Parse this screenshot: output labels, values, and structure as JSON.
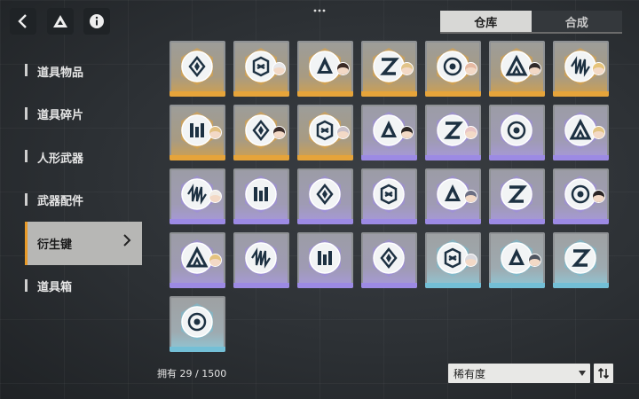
{
  "header": {
    "back_icon": "back-arrow-icon",
    "drive_icon": "triangle-logo-icon",
    "info_icon": "info-icon",
    "more_icon": "ellipsis-icon"
  },
  "tabs": [
    {
      "label": "仓库",
      "active": true
    },
    {
      "label": "合成",
      "active": false
    }
  ],
  "sidebar": {
    "items": [
      {
        "label": "道具物品",
        "active": false
      },
      {
        "label": "道具碎片",
        "active": false
      },
      {
        "label": "人形武器",
        "active": false
      },
      {
        "label": "武器配件",
        "active": false
      },
      {
        "label": "衍生键",
        "active": true
      },
      {
        "label": "道具箱",
        "active": false
      }
    ]
  },
  "items": [
    {
      "rarity": "gold",
      "emblem": "gem-crest-icon",
      "avatar": false
    },
    {
      "rarity": "gold",
      "emblem": "knot-crest-icon",
      "avatar": true,
      "avatar_hair": "#e7e7ea"
    },
    {
      "rarity": "gold",
      "emblem": "triangle-crest-icon",
      "avatar": true,
      "avatar_hair": "#3a2a25"
    },
    {
      "rarity": "gold",
      "emblem": "z-crest-icon",
      "avatar": true,
      "avatar_hair": "#e2c489"
    },
    {
      "rarity": "gold",
      "emblem": "orbit-crest-icon",
      "avatar": true,
      "avatar_hair": "#e5b9a2"
    },
    {
      "rarity": "gold",
      "emblem": "mountain-crest-icon",
      "avatar": true,
      "avatar_hair": "#2f2a2a"
    },
    {
      "rarity": "gold",
      "emblem": "wave-crest-icon",
      "avatar": true,
      "avatar_hair": "#e6c47a"
    },
    {
      "rarity": "gold",
      "emblem": "pillar-crest-icon",
      "avatar": true,
      "avatar_hair": "#e2c081"
    },
    {
      "rarity": "gold",
      "emblem": "snowflake-crest-icon",
      "avatar": true,
      "avatar_hair": "#3b2c29"
    },
    {
      "rarity": "gold",
      "emblem": "slash-crest-icon",
      "avatar": true,
      "avatar_hair": "#c9c0c8"
    },
    {
      "rarity": "purple",
      "emblem": "ring-crest-icon",
      "avatar": true,
      "avatar_hair": "#2c2625"
    },
    {
      "rarity": "purple",
      "emblem": "eye-crest-icon",
      "avatar": true,
      "avatar_hair": "#e9c5c5"
    },
    {
      "rarity": "purple",
      "emblem": "leaf-crest-icon",
      "avatar": false
    },
    {
      "rarity": "purple",
      "emblem": "e-crest-icon",
      "avatar": true,
      "avatar_hair": "#e2c483"
    },
    {
      "rarity": "purple",
      "emblem": "tower-crest-icon",
      "avatar": true,
      "avatar_hair": "#f1ece6"
    },
    {
      "rarity": "purple",
      "emblem": "bars-crest-icon",
      "avatar": false
    },
    {
      "rarity": "purple",
      "emblem": "hex-crest-icon",
      "avatar": false
    },
    {
      "rarity": "purple",
      "emblem": "spiral-crest-icon",
      "avatar": false
    },
    {
      "rarity": "purple",
      "emblem": "diamond-crest-icon",
      "avatar": true,
      "avatar_hair": "#6b6e82"
    },
    {
      "rarity": "purple",
      "emblem": "flame-crest-icon",
      "avatar": false
    },
    {
      "rarity": "purple",
      "emblem": "gear-crest-icon",
      "avatar": true,
      "avatar_hair": "#2a2424"
    },
    {
      "rarity": "purple",
      "emblem": "hourglass-crest-icon",
      "avatar": true,
      "avatar_hair": "#e4c37f"
    },
    {
      "rarity": "purple",
      "emblem": "chain-crest-icon",
      "avatar": false
    },
    {
      "rarity": "purple",
      "emblem": "square-crest-icon",
      "avatar": false
    },
    {
      "rarity": "purple",
      "emblem": "shuriken-crest-icon",
      "avatar": false
    },
    {
      "rarity": "blue",
      "emblem": "split-crest-icon",
      "avatar": true,
      "avatar_hair": "#d9d9de"
    },
    {
      "rarity": "blue",
      "emblem": "arch-crest-icon",
      "avatar": true,
      "avatar_hair": "#4f5560"
    },
    {
      "rarity": "blue",
      "emblem": "nested-diamond-crest-icon",
      "avatar": false
    },
    {
      "rarity": "blue",
      "emblem": "capsule-crest-icon",
      "avatar": false
    }
  ],
  "footer": {
    "owned_label": "拥有",
    "owned_count": "29 / 1500",
    "sort_label": "稀有度",
    "sort_icon": "sort-order-icon"
  },
  "colors": {
    "gold": "#e6a43a",
    "purple": "#9c8ae4",
    "blue": "#73bfd6",
    "active_tab_bg": "#d8d8d6",
    "sidebar_accent": "#e89a28"
  }
}
